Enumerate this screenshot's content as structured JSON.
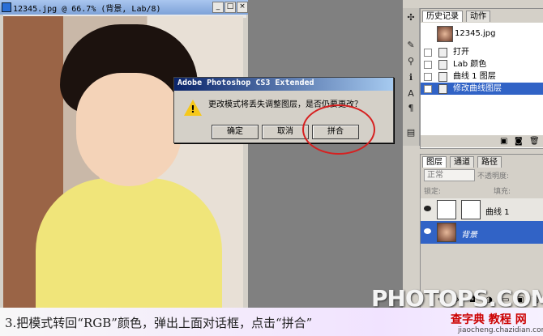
{
  "document": {
    "title": "12345.jpg @ 66.7% (背景, Lab/8)",
    "controls": [
      "_",
      "□",
      "×"
    ]
  },
  "history_panel": {
    "tabs": [
      "历史记录",
      "动作"
    ],
    "snapshot_name": "12345.jpg",
    "items": [
      {
        "label": "打开"
      },
      {
        "label": "Lab 颜色"
      },
      {
        "label": "曲线 1 图层"
      },
      {
        "label": "修改曲线图层",
        "selected": true
      }
    ]
  },
  "layers_panel": {
    "tabs": [
      "图层",
      "通道",
      "路径"
    ],
    "blend_mode": "正常",
    "opacity_label": "不透明度:",
    "lock_label": "锁定:",
    "fill_label": "填充:",
    "layers": [
      {
        "name": "曲线 1",
        "selected": false
      },
      {
        "name": "背景",
        "selected": true
      }
    ]
  },
  "dialog": {
    "title": "Adobe Photoshop CS3 Extended",
    "message": "更改模式将丢失调整图层，是否仍要更改？",
    "buttons": {
      "ok": "确定",
      "cancel": "取消",
      "flatten": "拼合"
    }
  },
  "caption": "3.把模式转回“RGB”颜色，弹出上面对话框，点击“拼合”",
  "watermarks": {
    "photops": "PHOTOPS.COM",
    "chazidian": "查字典 教程 网",
    "url": "jiaocheng.chazidian.com"
  },
  "colors": {
    "selection": "#3163c6",
    "highlight_circle": "#d62020",
    "dialog_title": "#0a246a"
  }
}
